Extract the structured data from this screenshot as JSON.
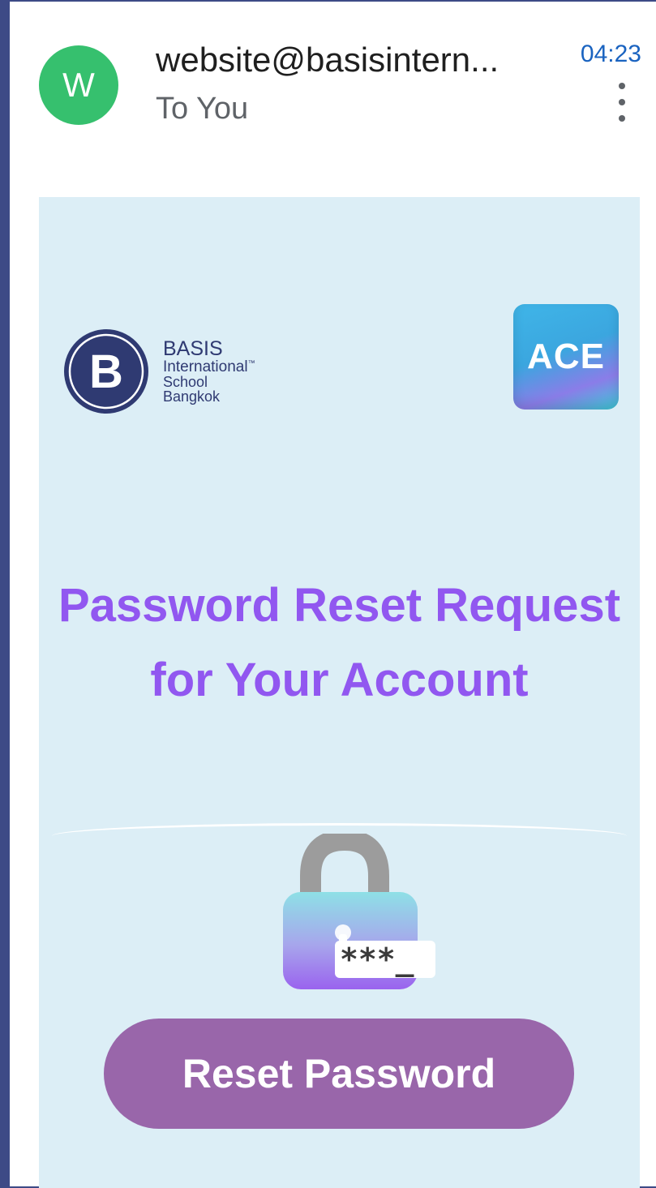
{
  "email": {
    "avatar_letter": "W",
    "sender": "website@basisintern...",
    "recipient": "To You",
    "time": "04:23"
  },
  "body": {
    "basis_logo": {
      "letter": "B",
      "line1": "BASIS",
      "line2": "International",
      "trademark": "™",
      "line3": "School",
      "line4": "Bangkok"
    },
    "ace_logo": "ACE",
    "title": "Password Reset Request for Your Account",
    "password_mask": "***_",
    "reset_button": "Reset Password"
  },
  "colors": {
    "avatar": "#36c06e",
    "title": "#9157f0",
    "button": "#9966aa",
    "content_background": "#dceef6",
    "time": "#1a63c0",
    "page_border": "#3d4a86"
  },
  "icons": [
    "more-vert-icon",
    "lock-icon"
  ]
}
